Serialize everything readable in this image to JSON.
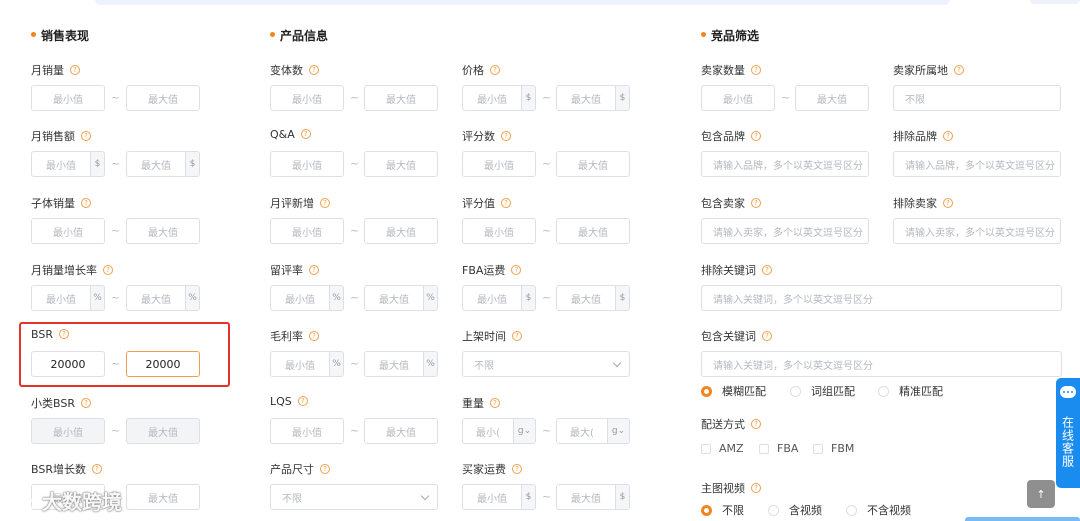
{
  "sections": {
    "sales": "销售表现",
    "product": "产品信息",
    "competitor": "竞品筛选"
  },
  "placeholders": {
    "min": "最小值",
    "max": "最大值",
    "min_short": "最小(",
    "max_short": "最大(",
    "any": "不限",
    "brand": "请输入品牌，多个以英文逗号区分",
    "seller": "请输入卖家，多个以英文逗号区分",
    "keyword": "请输入关键词，多个以英文逗号区分"
  },
  "units": {
    "dollar": "$",
    "percent": "%",
    "gram": "g"
  },
  "tilde": "~",
  "help": "?",
  "fields": {
    "monthly_sales": "月销量",
    "monthly_revenue": "月销售额",
    "child_sales": "子体销量",
    "sales_growth": "月销量增长率",
    "bsr": "BSR",
    "sub_bsr": "小类BSR",
    "bsr_growth": "BSR增长数",
    "variants": "变体数",
    "qa": "Q&A",
    "monthly_reviews": "月评新增",
    "review_rate": "留评率",
    "gross_margin": "毛利率",
    "lqs": "LQS",
    "product_size": "产品尺寸",
    "price": "价格",
    "rating_count": "评分数",
    "rating": "评分值",
    "fba_fee": "FBA运费",
    "listing_time": "上架时间",
    "weight": "重量",
    "buyer_shipping": "买家运费",
    "seller_count": "卖家数量",
    "seller_location": "卖家所属地",
    "include_brand": "包含品牌",
    "exclude_brand": "排除品牌",
    "include_seller": "包含卖家",
    "exclude_seller": "排除卖家",
    "exclude_keyword": "排除关键词",
    "include_keyword": "包含关键词",
    "delivery": "配送方式",
    "main_video": "主图视频"
  },
  "bsr_values": {
    "min": "20000",
    "max": "20000"
  },
  "match_modes": {
    "fuzzy": "模糊匹配",
    "phrase": "词组匹配",
    "exact": "精准匹配",
    "selected": "fuzzy"
  },
  "delivery_options": [
    "AMZ",
    "FBA",
    "FBM"
  ],
  "video_options": {
    "any": "不限",
    "with": "含视频",
    "without": "不含视频",
    "selected": "any"
  },
  "service_label": "在线客服",
  "to_top": "↑",
  "watermark": "大数跨境",
  "colors": {
    "accent": "#f0861d",
    "highlight": "#e5332a",
    "service": "#1a8cf0"
  }
}
